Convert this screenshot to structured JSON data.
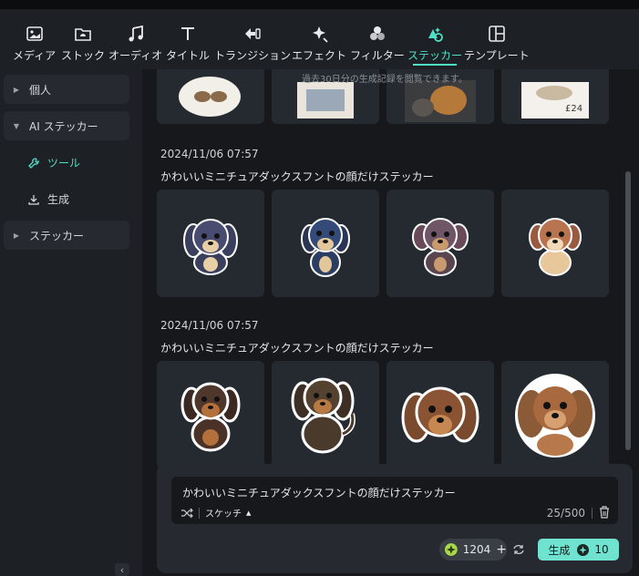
{
  "toolbar": {
    "items": [
      {
        "label": "メディア",
        "icon": "media-icon"
      },
      {
        "label": "ストック",
        "icon": "stock-icon"
      },
      {
        "label": "オーディオ",
        "icon": "music-note-icon"
      },
      {
        "label": "タイトル",
        "icon": "text-t-icon"
      },
      {
        "label": "トランジション",
        "icon": "transition-arrows-icon"
      },
      {
        "label": "エフェクト",
        "icon": "sparkle-wand-icon"
      },
      {
        "label": "フィルター",
        "icon": "filter-circles-icon"
      },
      {
        "label": "ステッカー",
        "icon": "sticker-shapes-icon"
      },
      {
        "label": "テンプレート",
        "icon": "template-layout-icon"
      }
    ],
    "active_index": 7,
    "accent_color": "#4fe0c8"
  },
  "sidebar": {
    "groups": [
      {
        "label": "個人",
        "expanded": false
      },
      {
        "label": "AI ステッカー",
        "expanded": true
      },
      {
        "label": "ステッカー",
        "expanded": false
      }
    ],
    "ai_sub_items": [
      {
        "label": "ツール",
        "icon": "wrench-icon",
        "active": true
      },
      {
        "label": "生成",
        "icon": "download-tray-icon",
        "active": false
      }
    ]
  },
  "main": {
    "history_hint": "過去30日分の生成記録を閲覧できます。",
    "sections": [
      {
        "date": "2024/11/06 07:57",
        "prompt": "かわいいミニチュアダックスフントの顔だけステッカー",
        "images": [
          "dark-navy-puppy-sticker",
          "navy-puppy-sticker",
          "purple-brown-puppy-sticker",
          "tan-puppy-sticker"
        ]
      },
      {
        "date": "2024/11/06 07:57",
        "prompt": "かわいいミニチュアダックスフントの顔だけステッカー",
        "images": [
          "chocolate-dachshund-sticker",
          "long-hair-dachshund-sticker",
          "dachshund-face-sticker",
          "fluffy-dachshund-sticker"
        ]
      }
    ],
    "partial_top_row_tag": "£24"
  },
  "composer": {
    "prompt_text": "かわいいミニチュアダックスフントの顔だけステッカー",
    "style_label": "スケッチ",
    "char_count": "25/500",
    "credits": "1204",
    "generate_label": "生成",
    "generate_cost": "10"
  }
}
